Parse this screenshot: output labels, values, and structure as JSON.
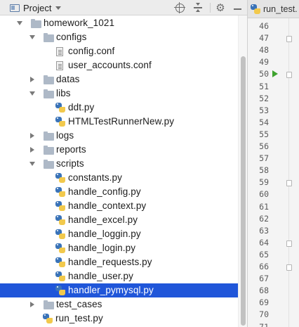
{
  "panel": {
    "title": "Project",
    "icons": {
      "project": "project-icon",
      "locate": "crosshair-icon",
      "collapse": "collapse-all-icon",
      "settings": "gear-icon",
      "hide": "minimize-icon"
    }
  },
  "tree": {
    "items": [
      {
        "label": "homework_1021",
        "kind": "folder",
        "expanded": true
      },
      {
        "label": "configs",
        "kind": "folder",
        "expanded": true
      },
      {
        "label": "config.conf",
        "kind": "conf"
      },
      {
        "label": "user_accounts.conf",
        "kind": "conf"
      },
      {
        "label": "datas",
        "kind": "folder",
        "expanded": false
      },
      {
        "label": "libs",
        "kind": "folder",
        "expanded": true
      },
      {
        "label": "ddt.py",
        "kind": "py"
      },
      {
        "label": "HTMLTestRunnerNew.py",
        "kind": "py"
      },
      {
        "label": "logs",
        "kind": "folder",
        "expanded": false
      },
      {
        "label": "reports",
        "kind": "folder",
        "expanded": false
      },
      {
        "label": "scripts",
        "kind": "folder",
        "expanded": true
      },
      {
        "label": "constants.py",
        "kind": "py"
      },
      {
        "label": "handle_config.py",
        "kind": "py"
      },
      {
        "label": "handle_context.py",
        "kind": "py"
      },
      {
        "label": "handle_excel.py",
        "kind": "py"
      },
      {
        "label": "handle_loggin.py",
        "kind": "py"
      },
      {
        "label": "handle_login.py",
        "kind": "py"
      },
      {
        "label": "handle_requests.py",
        "kind": "py"
      },
      {
        "label": "handle_user.py",
        "kind": "py"
      },
      {
        "label": "handler_pymysql.py",
        "kind": "py",
        "selected": true
      },
      {
        "label": "test_cases",
        "kind": "folder",
        "expanded": false
      },
      {
        "label": "run_test.py",
        "kind": "py"
      }
    ]
  },
  "editor": {
    "tab_label": "run_test.",
    "line_numbers": [
      "46",
      "47",
      "48",
      "49",
      "50",
      "51",
      "52",
      "53",
      "54",
      "55",
      "56",
      "57",
      "58",
      "59",
      "60",
      "61",
      "62",
      "63",
      "64",
      "65",
      "66",
      "67",
      "68",
      "69",
      "70",
      "71"
    ],
    "run_line": "50"
  },
  "colors": {
    "selection": "#2056d9",
    "run_marker": "#3ea32e",
    "python_blue": "#3a73b8",
    "python_yellow": "#f2c94c"
  }
}
